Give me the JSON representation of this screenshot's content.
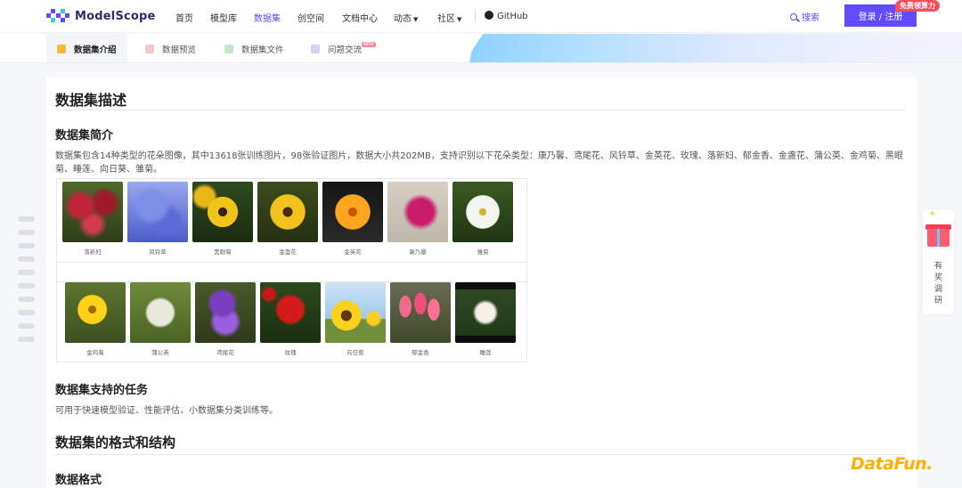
{
  "topnav": {
    "logo_text": "ModelScope",
    "items": [
      "首页",
      "模型库",
      "数据集",
      "创空间",
      "文档中心",
      "动态",
      "社区"
    ],
    "github": "GitHub",
    "search": "搜索",
    "login": "登录 / 注册",
    "promo": "免费领算力"
  },
  "subnav": {
    "tabs": [
      "数据集介绍",
      "数据预览",
      "数据集文件",
      "问题交流"
    ],
    "new_badge": "NEW"
  },
  "content": {
    "title": "数据集描述",
    "intro_heading": "数据集简介",
    "intro_text": "数据集包含14种类型的花朵图像，其中13618张训练图片，98张验证图片，数据大小共202MB，支持识别以下花朵类型：康乃馨、鸢尾花、风铃草、金英花、玫瑰、落新妇、郁金香、金盏花、蒲公英、金鸡菊、黑眼菊、睡莲、向日葵、雏菊。",
    "flowers_row1": [
      "落新妇",
      "风铃草",
      "黑眼菊",
      "金盏花",
      "金英花",
      "康乃馨",
      "雏菊"
    ],
    "flowers_row2": [
      "金鸡菊",
      "蒲公英",
      "鸢尾花",
      "玫瑰",
      "向日葵",
      "郁金香",
      "睡莲"
    ],
    "tasks_heading": "数据集支持的任务",
    "tasks_text": "可用于快速模型验证、性能评估、小数据集分类训练等。",
    "format_heading": "数据集的格式和结构",
    "format_sub": "数据格式"
  },
  "side_widget": {
    "text": [
      "有",
      "奖",
      "调",
      "研"
    ]
  },
  "watermark": "DataFun.",
  "colors": {
    "accent": "#624aff",
    "promo": "#ff4c5c",
    "watermark": "#ffb000"
  }
}
